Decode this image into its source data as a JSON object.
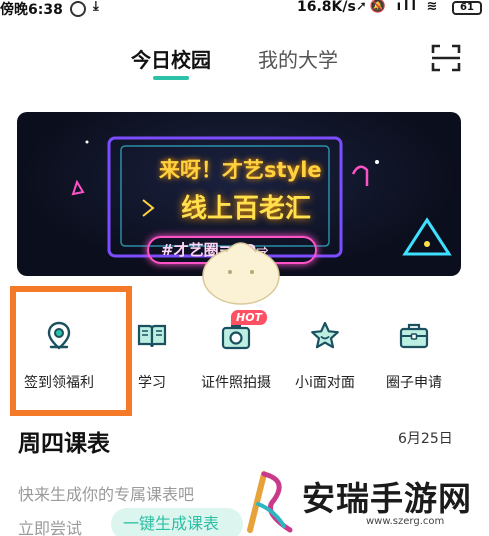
{
  "status": {
    "time": "傍晚6:38",
    "speed": "16.8K/s",
    "battery": "61"
  },
  "header": {
    "tabs": [
      {
        "label": "今日校园",
        "active": true
      },
      {
        "label": "我的大学",
        "active": false
      }
    ],
    "scan_icon": "scan-icon"
  },
  "banner": {
    "line1": "来呀！才艺style",
    "line2": "线上百老汇",
    "pill": "#才艺圈≡GO⇨"
  },
  "features": [
    {
      "label": "签到领福利",
      "icon": "location-pin-icon"
    },
    {
      "label": "学习",
      "icon": "book-icon"
    },
    {
      "label": "证件照拍摄",
      "icon": "camera-icon",
      "badge": "HOT"
    },
    {
      "label": "小i面对面",
      "icon": "star-icon"
    },
    {
      "label": "圈子申请",
      "icon": "briefcase-icon"
    }
  ],
  "schedule": {
    "title": "周四课表",
    "date": "6月25日",
    "hint": "快来生成你的专属课表吧",
    "try_label": "立即尝试",
    "generate_label": "一键生成课表"
  },
  "watermark": {
    "name": "安瑞手游网",
    "url": "www.szerg.com"
  },
  "colors": {
    "accent": "#2cc2a8",
    "highlight": "#f47a2a",
    "hot": "#ff4f62"
  }
}
